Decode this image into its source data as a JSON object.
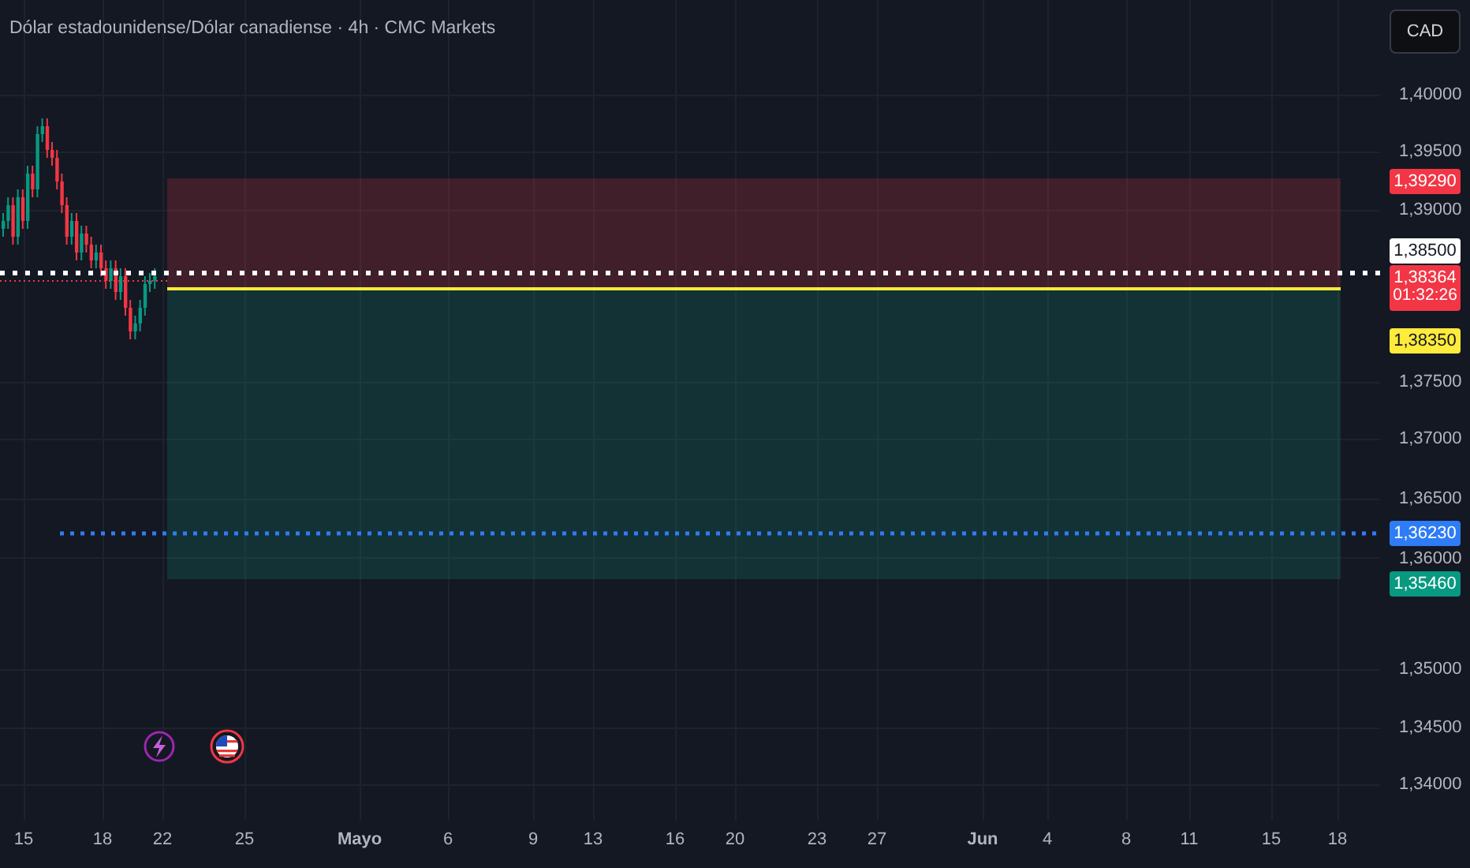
{
  "header": {
    "title": "Dólar estadounidense/Dólar canadiense · 4h · CMC Markets"
  },
  "currency_button": {
    "label": "CAD"
  },
  "price_axis": {
    "ticks": [
      "1,40000",
      "1,39500",
      "1,39000",
      "1,37500",
      "1,37000",
      "1,36500",
      "1,36000",
      "1,35000",
      "1,34500",
      "1,34000"
    ],
    "tags": [
      {
        "kind": "stop",
        "text": "1,39290",
        "color": "#f23645"
      },
      {
        "kind": "line",
        "text": "1,38500",
        "color": "#ffffff"
      },
      {
        "kind": "last",
        "text": "1,38364",
        "countdown": "01:32:26",
        "color": "#f23645"
      },
      {
        "kind": "entry",
        "text": "1,38350",
        "color": "#ffeb3b"
      },
      {
        "kind": "alert",
        "text": "1,36230",
        "color": "#2e7cf6"
      },
      {
        "kind": "target",
        "text": "1,35460",
        "color": "#089981"
      }
    ]
  },
  "time_axis": [
    {
      "text": "15",
      "kind": "day"
    },
    {
      "text": "18",
      "kind": "day"
    },
    {
      "text": "22",
      "kind": "day"
    },
    {
      "text": "25",
      "kind": "day"
    },
    {
      "text": "Mayo",
      "kind": "month"
    },
    {
      "text": "6",
      "kind": "day"
    },
    {
      "text": "9",
      "kind": "day"
    },
    {
      "text": "13",
      "kind": "day"
    },
    {
      "text": "16",
      "kind": "day"
    },
    {
      "text": "20",
      "kind": "day"
    },
    {
      "text": "23",
      "kind": "day"
    },
    {
      "text": "27",
      "kind": "day"
    },
    {
      "text": "Jun",
      "kind": "month"
    },
    {
      "text": "4",
      "kind": "day"
    },
    {
      "text": "8",
      "kind": "day"
    },
    {
      "text": "11",
      "kind": "day"
    },
    {
      "text": "15",
      "kind": "day"
    },
    {
      "text": "18",
      "kind": "day"
    }
  ]
}
